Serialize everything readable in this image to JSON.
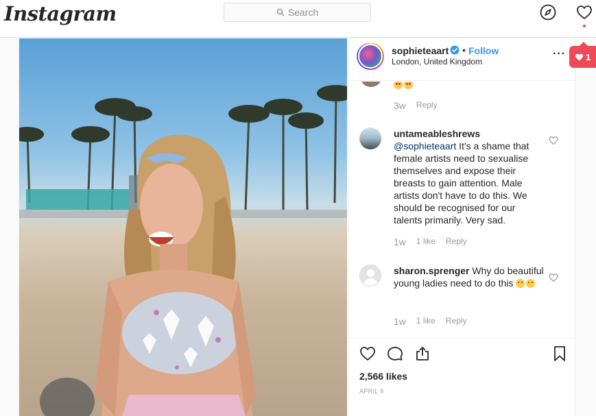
{
  "app": {
    "logo_text": "Instagram"
  },
  "search": {
    "placeholder": "Search"
  },
  "nav": {
    "icons": [
      "compass-icon",
      "heart-icon"
    ]
  },
  "post": {
    "username": "sophieteaart",
    "verified": true,
    "follow_label": "Follow",
    "separator": "•",
    "location": "London, United Kingdom",
    "more_label": "···",
    "likes": "2,566 likes",
    "date": "April 9"
  },
  "comments": [
    {
      "user": "",
      "text": "",
      "emoji": [
        "heart-eyes",
        "heart-eyes"
      ],
      "time": "3w",
      "likes": "",
      "reply_label": "Reply"
    },
    {
      "user": "untameableshrews",
      "mention": "@sophieteaart",
      "text": "It's a shame that female artists need to sexualise themselves and expose their breasts to gain attention. Male artists don't have to do this. We should be recognised for our talents primarily. Very sad.",
      "time": "1w",
      "likes": "1 like",
      "reply_label": "Reply"
    },
    {
      "user": "sharon.sprenger",
      "text": "Why do beautiful young ladies need to do this",
      "emoji": [
        "disappointed",
        "disappointed"
      ],
      "time": "1w",
      "likes": "1 like",
      "reply_label": "Reply"
    }
  ],
  "activity": {
    "count": "1"
  },
  "colors": {
    "accent": "#3897f0",
    "notification": "#ed4956",
    "text": "#262626",
    "muted": "#999999"
  }
}
